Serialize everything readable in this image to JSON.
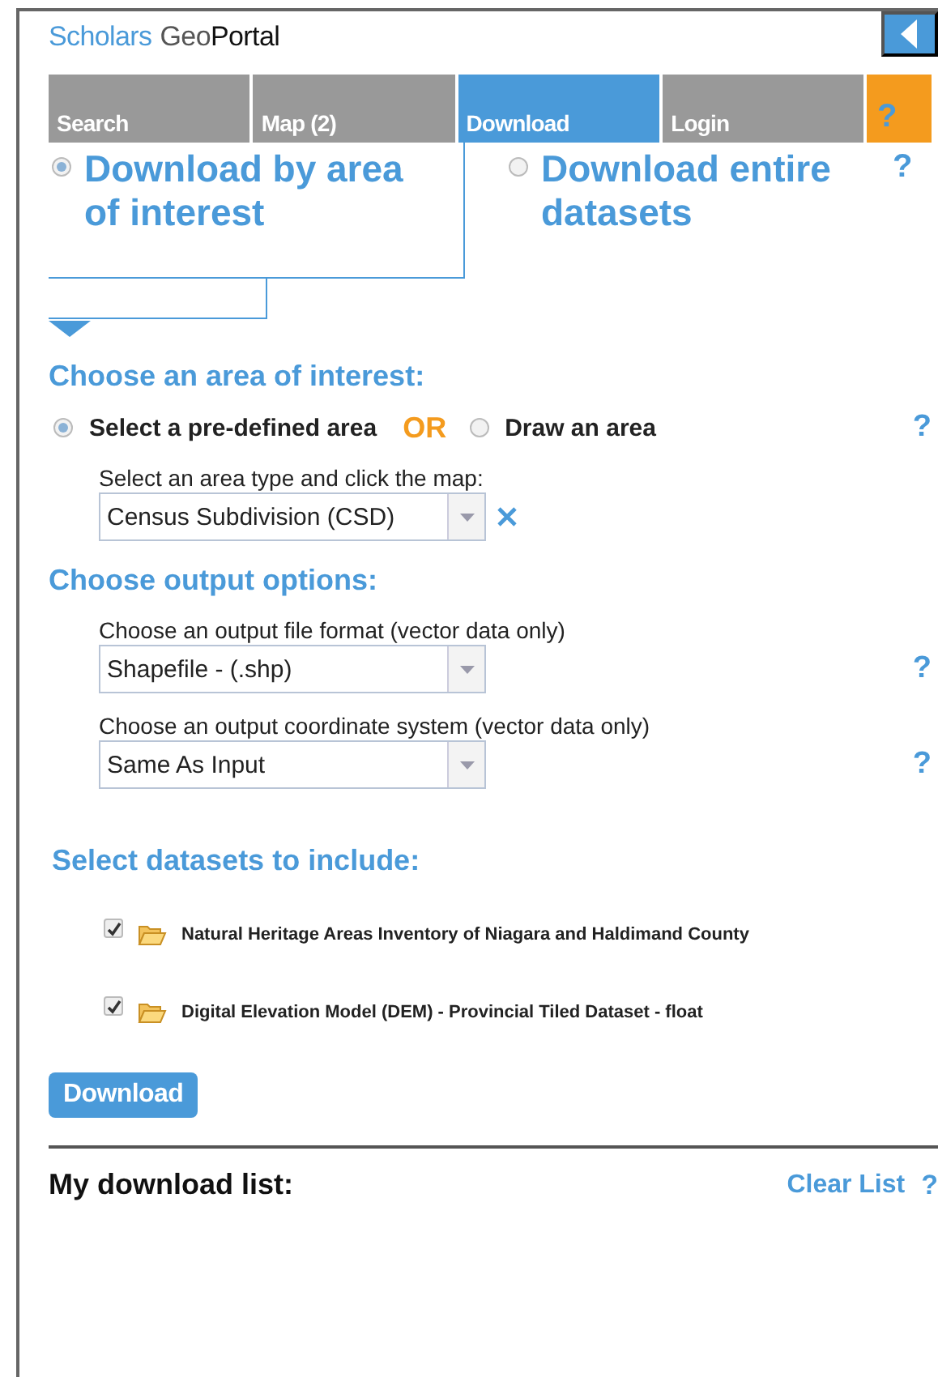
{
  "logo": {
    "part1": "Scholars",
    "part2": "Geo",
    "part3": "Portal"
  },
  "tabs": [
    {
      "label": "Search",
      "selected": false,
      "kind": "text"
    },
    {
      "label": "Map (2)",
      "selected": false,
      "kind": "text"
    },
    {
      "label": "Download",
      "selected": true,
      "kind": "text"
    },
    {
      "label": "Login",
      "selected": false,
      "kind": "text"
    },
    {
      "label": "?",
      "selected": false,
      "kind": "help"
    }
  ],
  "modes": [
    {
      "label": "Download by area of interest",
      "selected": true
    },
    {
      "label": "Download entire datasets",
      "selected": false
    }
  ],
  "mode_help": "?",
  "area": {
    "heading": "Choose an area of interest:",
    "options": [
      {
        "label": "Select a pre-defined area",
        "selected": true
      },
      {
        "label": "Draw an area",
        "selected": false
      }
    ],
    "or": "OR",
    "help": "?",
    "field": {
      "label": "Select an area type and click the map:",
      "value": "Census Subdivision (CSD)",
      "clearable": true
    }
  },
  "output": {
    "heading": "Choose output options:",
    "fields": [
      {
        "label": "Choose an output file format (vector data only)",
        "value": "Shapefile - (.shp)",
        "help": "?"
      },
      {
        "label": "Choose an output coordinate system (vector data only)",
        "value": "Same As Input",
        "help": "?"
      }
    ]
  },
  "datasets": {
    "heading": "Select datasets to include:",
    "items": [
      {
        "name": "Natural Heritage Areas Inventory of Niagara and Haldimand County",
        "checked": true
      },
      {
        "name": "Digital Elevation Model (DEM) - Provincial Tiled Dataset - float",
        "checked": true
      }
    ]
  },
  "download_button": "Download",
  "download_list": {
    "title": "My download list:",
    "clear": "Clear List",
    "help": "?"
  }
}
